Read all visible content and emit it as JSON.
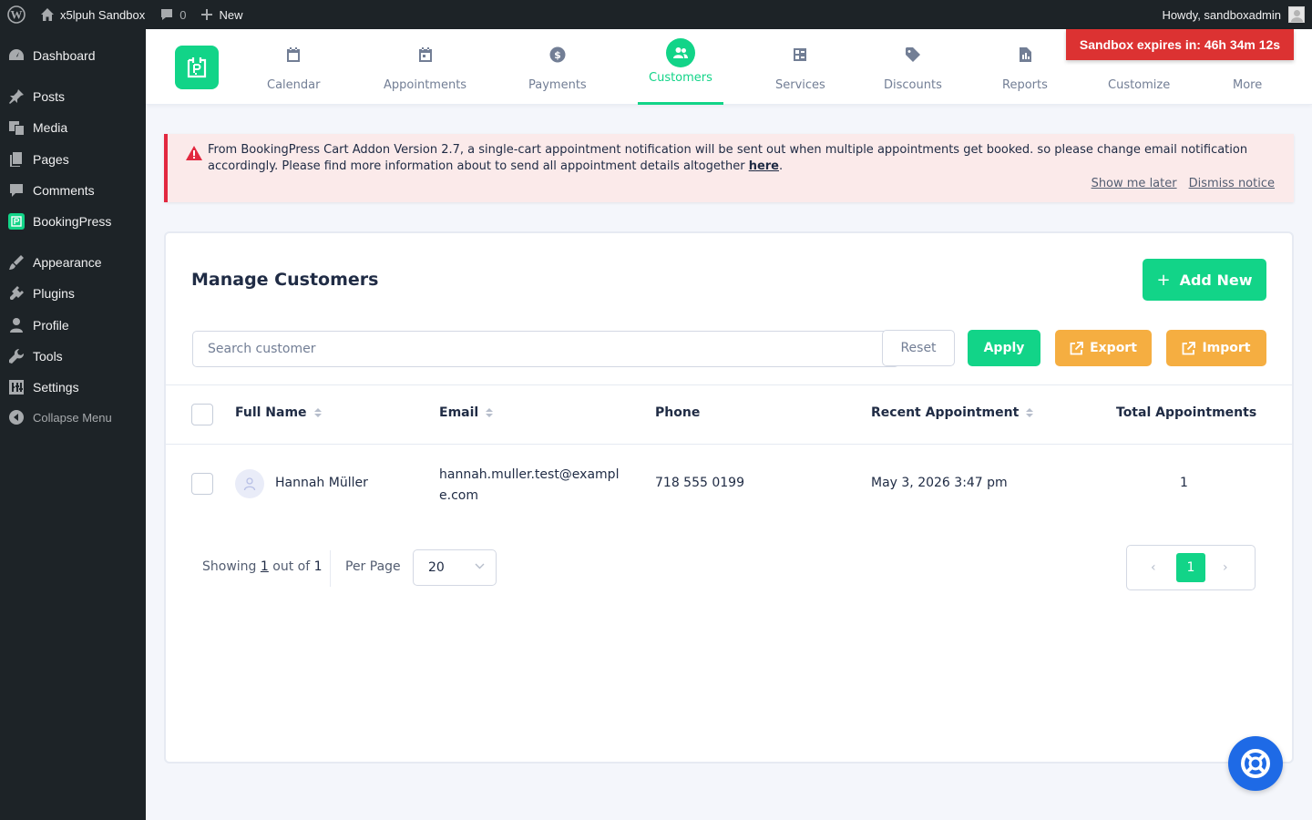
{
  "adminbar": {
    "site_name": "x5lpuh Sandbox",
    "comments_count": "0",
    "new_label": "New",
    "howdy": "Howdy, sandboxadmin"
  },
  "sidebar": {
    "items": [
      {
        "label": "Dashboard",
        "icon": "dashboard-icon"
      },
      {
        "label": "Posts",
        "icon": "pin-icon"
      },
      {
        "label": "Media",
        "icon": "media-icon"
      },
      {
        "label": "Pages",
        "icon": "pages-icon"
      },
      {
        "label": "Comments",
        "icon": "comment-icon"
      },
      {
        "label": "BookingPress",
        "icon": "bookingpress-icon"
      },
      {
        "label": "Appearance",
        "icon": "brush-icon"
      },
      {
        "label": "Plugins",
        "icon": "plugin-icon"
      },
      {
        "label": "Profile",
        "icon": "user-icon"
      },
      {
        "label": "Tools",
        "icon": "wrench-icon"
      },
      {
        "label": "Settings",
        "icon": "settings-icon"
      },
      {
        "label": "Collapse Menu",
        "icon": "collapse-icon"
      }
    ]
  },
  "nav": {
    "items": [
      {
        "label": "Calendar",
        "icon": "calendar-icon"
      },
      {
        "label": "Appointments",
        "icon": "appointment-icon"
      },
      {
        "label": "Payments",
        "icon": "dollar-icon"
      },
      {
        "label": "Customers",
        "icon": "customers-icon",
        "active": true
      },
      {
        "label": "Services",
        "icon": "services-icon"
      },
      {
        "label": "Discounts",
        "icon": "tag-icon"
      },
      {
        "label": "Reports",
        "icon": "report-icon"
      },
      {
        "label": "Customize",
        "icon": ""
      },
      {
        "label": "More",
        "icon": ""
      }
    ]
  },
  "sandbox_badge": "Sandbox expires in: 46h 34m 12s",
  "notice": {
    "text": "From BookingPress Cart Addon Version 2.7, a single-cart appointment notification will be sent out when multiple appointments get booked. so please change email notification accordingly. Please find more information about to send all appointment details altogether ",
    "link": "here",
    "period": ".",
    "show_later": "Show me later",
    "dismiss": "Dismiss notice"
  },
  "main": {
    "title": "Manage Customers",
    "add_new": "Add New",
    "search_placeholder": "Search customer",
    "reset": "Reset",
    "apply": "Apply",
    "export": "Export",
    "import": "Import"
  },
  "table": {
    "columns": [
      "Full Name",
      "Email",
      "Phone",
      "Recent Appointment",
      "Total Appointments"
    ],
    "rows": [
      {
        "name": "Hannah Müller",
        "email_line1": "hannah.muller.test@exampl",
        "email_line2": "e.com",
        "phone": "718 555 0199",
        "recent": "May 3, 2026 3:47 pm",
        "total": "1"
      }
    ]
  },
  "pagination": {
    "showing": "Showing",
    "current": "1",
    "out_of": "out of",
    "total": "1",
    "per_page_label": "Per Page",
    "per_page_value": "20",
    "prev": "‹",
    "page": "1",
    "next": "›"
  },
  "colors": {
    "accent": "#12d488",
    "warning": "#f5ae41",
    "danger": "#dc3232",
    "help": "#1e6ae6"
  }
}
